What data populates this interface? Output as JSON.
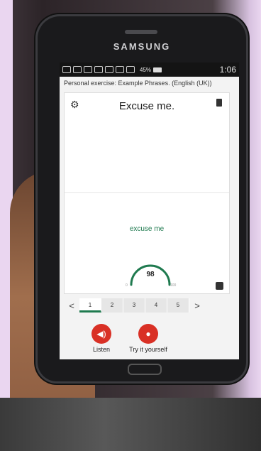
{
  "device": {
    "brand": "SAMSUNG"
  },
  "statusbar": {
    "battery": "45%",
    "time": "1:06"
  },
  "app": {
    "exercise_title": "Personal exercise: Example Phrases. (English (UK))",
    "card": {
      "settings_icon": "gear-icon",
      "delete_icon": "trash-icon",
      "phrase": "Excuse me.",
      "recognized_text": "excuse me",
      "score": {
        "value": "98",
        "min_label": "0",
        "max_label": "100",
        "level": 0.98
      },
      "stats_icon": "bar-chart-icon"
    },
    "pager": {
      "prev": "<",
      "next": ">",
      "pages": [
        "1",
        "2",
        "3",
        "4",
        "5"
      ],
      "active_page": "1"
    },
    "actions": {
      "listen_label": "Listen",
      "try_label": "Try it yourself"
    }
  },
  "colors": {
    "accent_green": "#1f7a4f",
    "action_red": "#d93025"
  }
}
